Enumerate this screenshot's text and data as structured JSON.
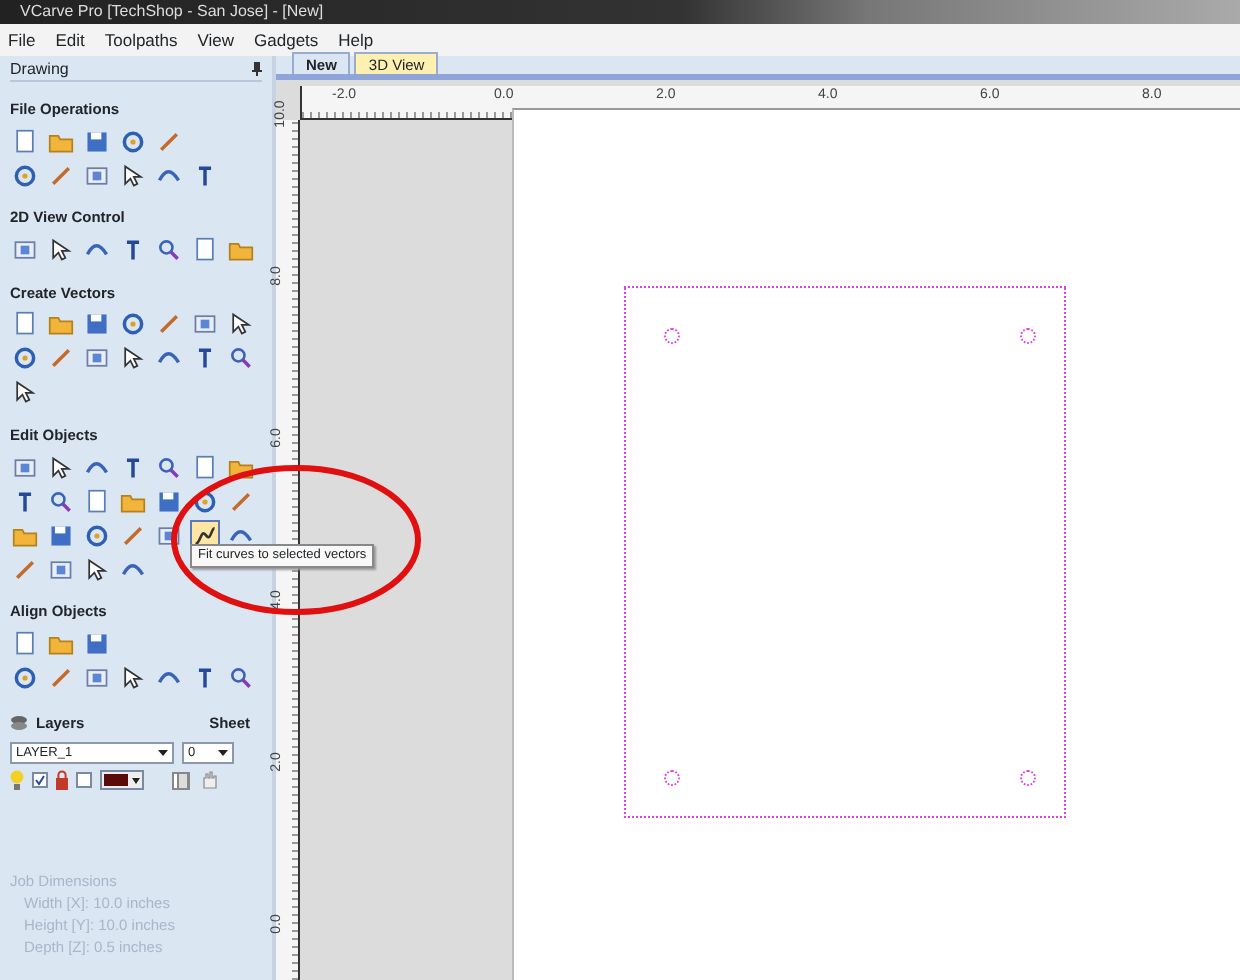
{
  "window": {
    "title": "VCarve Pro [TechShop - San Jose] - [New]"
  },
  "menu": [
    "File",
    "Edit",
    "Toolpaths",
    "View",
    "Gadgets",
    "Help"
  ],
  "panel": {
    "title": "Drawing",
    "sections": [
      {
        "title": "File Operations",
        "rows": [
          [
            {
              "selected": false
            },
            {
              "selected": false
            },
            {
              "selected": false
            },
            {
              "selected": false
            },
            {
              "selected": false
            }
          ],
          [
            {
              "selected": false
            },
            {
              "selected": false
            },
            {
              "selected": false
            },
            {
              "selected": false
            },
            {
              "selected": false
            },
            {
              "selected": false
            }
          ]
        ]
      },
      {
        "title": "2D View Control",
        "rows": [
          [
            {
              "selected": false
            },
            {
              "selected": false
            },
            {
              "selected": false
            },
            {
              "selected": false
            },
            {
              "selected": false
            },
            {
              "selected": false
            },
            {
              "selected": false
            }
          ]
        ]
      },
      {
        "title": "Create Vectors",
        "rows": [
          [
            {
              "selected": false
            },
            {
              "selected": false
            },
            {
              "selected": false
            },
            {
              "selected": false
            },
            {
              "selected": false
            },
            {
              "selected": false
            },
            {
              "selected": false
            }
          ],
          [
            {
              "selected": false
            },
            {
              "selected": false
            },
            {
              "selected": false
            },
            {
              "selected": false
            },
            {
              "selected": false
            },
            {
              "selected": false
            },
            {
              "selected": false
            }
          ],
          [
            {
              "selected": false
            }
          ]
        ]
      },
      {
        "title": "Edit Objects",
        "rows": [
          [
            {
              "selected": false
            },
            {
              "selected": false
            },
            {
              "selected": false
            },
            {
              "selected": false
            },
            {
              "selected": false
            },
            {
              "selected": false
            },
            {
              "selected": false
            }
          ],
          [
            {
              "selected": false
            },
            {
              "selected": false
            },
            {
              "selected": false
            },
            {
              "selected": false
            },
            {
              "selected": false
            },
            {
              "selected": false
            },
            {
              "selected": false
            }
          ],
          [
            {
              "selected": false
            },
            {
              "selected": false
            },
            {
              "selected": false
            },
            {
              "selected": false
            },
            {
              "selected": false
            },
            {
              "selected": true
            },
            {
              "selected": false
            }
          ],
          [
            {
              "selected": false
            },
            {
              "selected": false
            },
            {
              "selected": false
            },
            {
              "selected": false
            }
          ]
        ]
      },
      {
        "title": "Align Objects",
        "rows": [
          [
            {
              "selected": false
            },
            {
              "selected": false
            },
            {
              "selected": false
            }
          ],
          [
            {
              "selected": false
            },
            {
              "selected": false
            },
            {
              "selected": false
            },
            {
              "selected": false
            },
            {
              "selected": false
            },
            {
              "selected": false
            },
            {
              "selected": false
            }
          ]
        ]
      }
    ]
  },
  "layers": {
    "title": "Layers",
    "sheet_label": "Sheet",
    "layer": "LAYER_1",
    "sheet": "0",
    "visible": true,
    "locked": false
  },
  "job_dimensions": {
    "disabled": true,
    "title": "Job Dimensions",
    "lines": [
      "Width [X]: 10.0 inches",
      "Height [Y]: 10.0 inches",
      "Depth [Z]: 0.5 inches"
    ]
  },
  "tooltip": "Fit curves to selected vectors",
  "tabs": [
    {
      "label": "New",
      "selected": true
    },
    {
      "label": "3D View",
      "selected": false
    }
  ],
  "ruler": {
    "x_labels": [
      "-2.0",
      "0.0",
      "2.0",
      "4.0",
      "6.0",
      "8.0"
    ],
    "y_labels": [
      "10.0",
      "8.0",
      "6.0",
      "4.0",
      "2.0",
      "0.0"
    ]
  }
}
